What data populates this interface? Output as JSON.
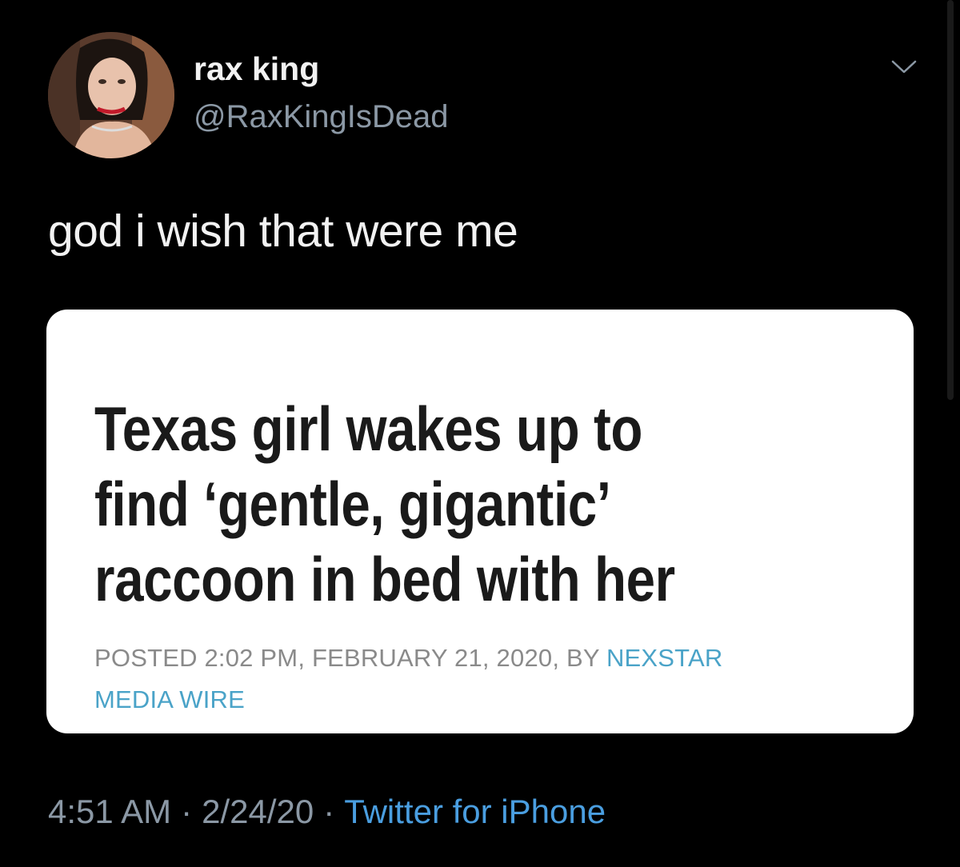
{
  "user": {
    "display_name": "rax king",
    "handle": "@RaxKingIsDead",
    "avatar_icon": "profile-photo"
  },
  "tweet": {
    "text": "god i wish that were me"
  },
  "card": {
    "headline_lines": [
      "Texas girl wakes up to",
      "find ‘gentle, gigantic’",
      "raccoon in bed with her"
    ],
    "byline_prefix": "POSTED 2:02 PM, FEBRUARY 21, 2020, BY",
    "byline_author_part1": "NEXSTAR",
    "byline_author_part2": "MEDIA WIRE"
  },
  "meta": {
    "time": "4:51 AM",
    "separator": "·",
    "date": "2/24/20",
    "source": "Twitter for iPhone"
  },
  "colors": {
    "background": "#000000",
    "secondary_text": "#8b98a5",
    "link": "#4a9ee0",
    "byline_link": "#4aa3c8"
  },
  "icons": {
    "more": "chevron-down-icon"
  }
}
